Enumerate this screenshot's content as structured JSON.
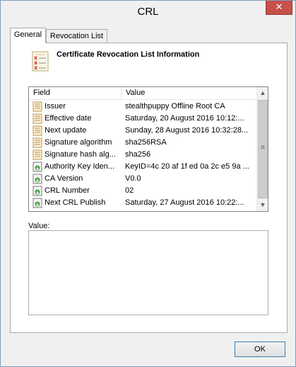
{
  "window": {
    "title": "CRL",
    "close_glyph": "✕"
  },
  "tabs": [
    {
      "label": "General",
      "active": true
    },
    {
      "label": "Revocation List",
      "active": false
    }
  ],
  "general": {
    "heading": "Certificate Revocation List Information",
    "heading_icon": "certificate-list-icon"
  },
  "list": {
    "columns": {
      "field": "Field",
      "value": "Value"
    },
    "rows": [
      {
        "icon": "document-icon",
        "field": "Issuer",
        "value": "stealthpuppy Offline Root CA"
      },
      {
        "icon": "document-icon",
        "field": "Effective date",
        "value": "Saturday, 20 August 2016 10:12:..."
      },
      {
        "icon": "document-icon",
        "field": "Next update",
        "value": "Sunday, 28 August 2016 10:32:28..."
      },
      {
        "icon": "document-icon",
        "field": "Signature algorithm",
        "value": "sha256RSA"
      },
      {
        "icon": "document-icon",
        "field": "Signature hash alg...",
        "value": "sha256"
      },
      {
        "icon": "extension-icon",
        "field": "Authority Key Iden...",
        "value": "KeyID=4c 20 af 1f ed 0a 2c e5 9a ..."
      },
      {
        "icon": "extension-icon",
        "field": "CA Version",
        "value": "V0.0"
      },
      {
        "icon": "extension-icon",
        "field": "CRL Number",
        "value": "02"
      },
      {
        "icon": "extension-icon",
        "field": "Next CRL Publish",
        "value": "Saturday, 27 August 2016 10:22:..."
      }
    ]
  },
  "value_label": "Value:",
  "value_text": "",
  "buttons": {
    "ok": "OK"
  },
  "colors": {
    "close": "#c7504a",
    "accent": "#3c7fb1"
  }
}
